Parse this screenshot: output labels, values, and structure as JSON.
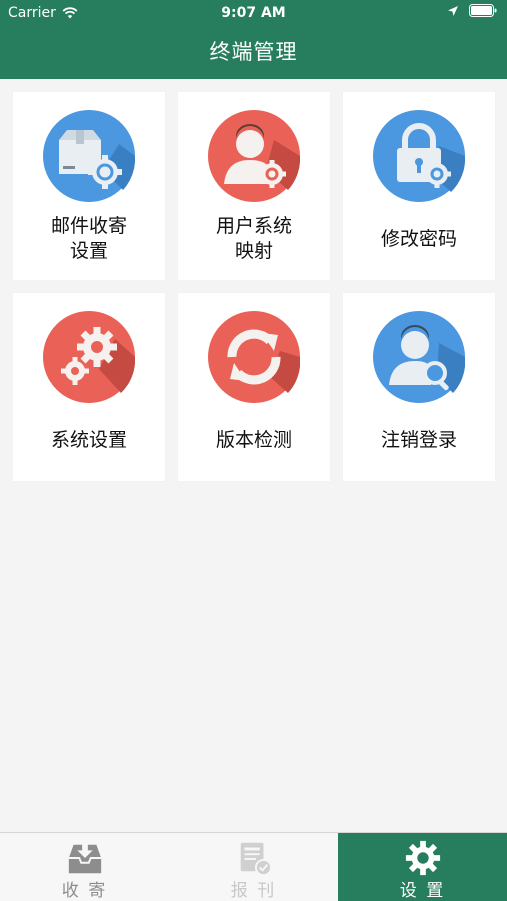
{
  "status_bar": {
    "carrier": "Carrier",
    "time": "9:07 AM"
  },
  "header": {
    "title": "终端管理"
  },
  "tiles": [
    {
      "label": "邮件收寄\n设置",
      "icon": "package-gear-icon",
      "color": "#4b97e0"
    },
    {
      "label": "用户系统\n映射",
      "icon": "user-gear-icon",
      "color": "#e96157"
    },
    {
      "label": "修改密码",
      "icon": "lock-gear-icon",
      "color": "#4b97e0"
    },
    {
      "label": "系统设置",
      "icon": "gears-icon",
      "color": "#e96157"
    },
    {
      "label": "版本检测",
      "icon": "refresh-icon",
      "color": "#e96157"
    },
    {
      "label": "注销登录",
      "icon": "user-search-icon",
      "color": "#4b97e0"
    }
  ],
  "tabbar": {
    "tabs": [
      {
        "label": "收 寄",
        "icon": "inbox-download-icon",
        "active": false
      },
      {
        "label": "报 刊",
        "icon": "newspaper-check-icon",
        "active": false
      },
      {
        "label": "设 置",
        "icon": "gear-icon",
        "active": true
      }
    ]
  },
  "colors": {
    "brand_green": "#267e5e",
    "blue": "#4b97e0",
    "red": "#e96157"
  }
}
